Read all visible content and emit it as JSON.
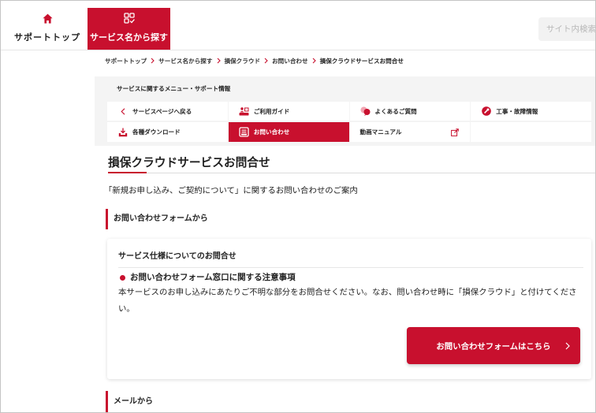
{
  "colors": {
    "accent": "#c8102e",
    "menu_bg": "#f4f4f4",
    "text": "#222222"
  },
  "header": {
    "nav": [
      {
        "label": "サポートトップ",
        "icon": "house-icon"
      },
      {
        "label": "サービス名から探す",
        "icon": "grid-check-icon",
        "active": true
      }
    ],
    "search_placeholder": "サイト内検索"
  },
  "breadcrumb": [
    "サポートトップ",
    "サービス名から探す",
    "損保クラウド",
    "お問い合わせ",
    "損保クラウドサービスお問合せ"
  ],
  "menu": {
    "title": "サービスに関するメニュー・サポート情報",
    "items": [
      {
        "label": "サービスページへ戻る",
        "icon": "chevron-left-icon"
      },
      {
        "label": "ご利用ガイド",
        "icon": "guide-icon"
      },
      {
        "label": "よくあるご質問",
        "icon": "faq-icon"
      },
      {
        "label": "工事・故障情報",
        "icon": "alert-wrench-icon"
      },
      {
        "label": "各種ダウンロード",
        "icon": "download-icon"
      },
      {
        "label": "お問い合わせ",
        "icon": "form-icon",
        "active": true
      },
      {
        "label": "動画マニュアル",
        "icon": "external-link-icon"
      }
    ]
  },
  "page": {
    "title": "損保クラウドサービスお問合せ",
    "description": "「新規お申し込み、ご契約について」に関するお問い合わせのご案内"
  },
  "form_section": {
    "heading": "お問い合わせフォームから",
    "card": {
      "title": "サービス仕様についてのお問合せ",
      "notice_heading": "お問い合わせフォーム窓口に関する注意事項",
      "notice_text": "本サービスのお申し込みにあたりご不明な部分をお問合せください。なお、問い合わせ時に「損保クラウド」と付けてください。",
      "button_label": "お問い合わせフォームはこちら"
    }
  },
  "mail_section": {
    "heading": "メールから"
  }
}
